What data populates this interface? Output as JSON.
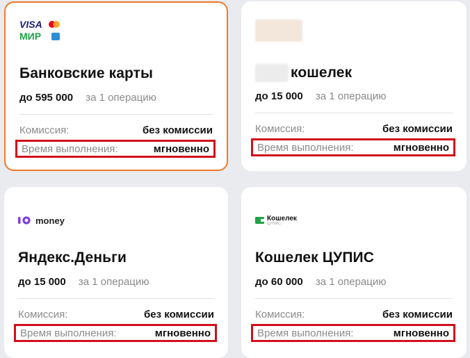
{
  "cards": [
    {
      "title": "Банковские карты",
      "limit_amount": "до 595 000",
      "limit_per": "за 1 операцию",
      "commission_label": "Комиссия:",
      "commission_value": "без комиссии",
      "time_label": "Время выполнения:",
      "time_value": "мгновенно",
      "logos": {
        "visa": "VISA",
        "mir": "МИР"
      }
    },
    {
      "title": "кошелек",
      "limit_amount": "до 15 000",
      "limit_per": "за 1 операцию",
      "commission_label": "Комиссия:",
      "commission_value": "без комиссии",
      "time_label": "Время выполнения:",
      "time_value": "мгновенно"
    },
    {
      "title": "Яндекс.Деньги",
      "limit_amount": "до 15 000",
      "limit_per": "за 1 операцию",
      "commission_label": "Комиссия:",
      "commission_value": "без комиссии",
      "time_label": "Время выполнения:",
      "time_value": "мгновенно",
      "logo_text": "money"
    },
    {
      "title": "Кошелек ЦУПИС",
      "limit_amount": "до 60 000",
      "limit_per": "за 1 операцию",
      "commission_label": "Комиссия:",
      "commission_value": "без комиссии",
      "time_label": "Время выполнения:",
      "time_value": "мгновенно",
      "logo_text": "Кошелек",
      "logo_subtext": "ЦУПИС"
    }
  ],
  "colors": {
    "selected_border": "#f07a2a",
    "highlight_border": "#d0101a",
    "background": "#e9ebee"
  }
}
